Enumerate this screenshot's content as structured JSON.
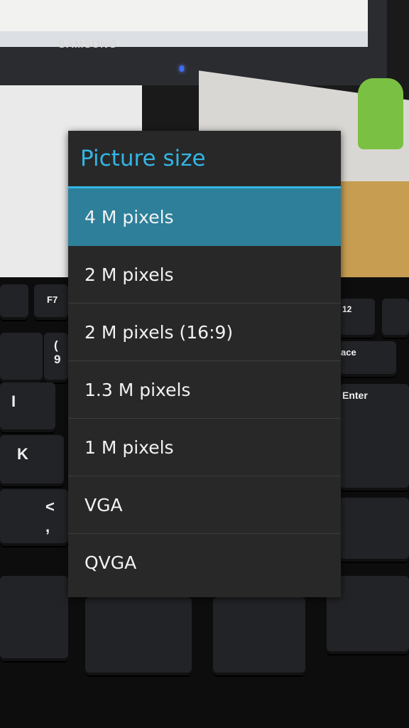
{
  "background": {
    "monitor_brand": "SAMSUNG",
    "keys": [
      "F7",
      "12",
      "(",
      "9",
      "I",
      "K",
      "<",
      ",",
      "ace",
      "Enter"
    ]
  },
  "dialog": {
    "title": "Picture size",
    "accent_color": "#33b5e5",
    "selected_color": "#2d7f9a",
    "selected_index": 0,
    "options": [
      {
        "label": "4 M pixels"
      },
      {
        "label": "2 M pixels"
      },
      {
        "label": "2 M pixels (16:9)"
      },
      {
        "label": "1.3 M pixels"
      },
      {
        "label": "1 M pixels"
      },
      {
        "label": "VGA"
      },
      {
        "label": "QVGA"
      }
    ]
  }
}
